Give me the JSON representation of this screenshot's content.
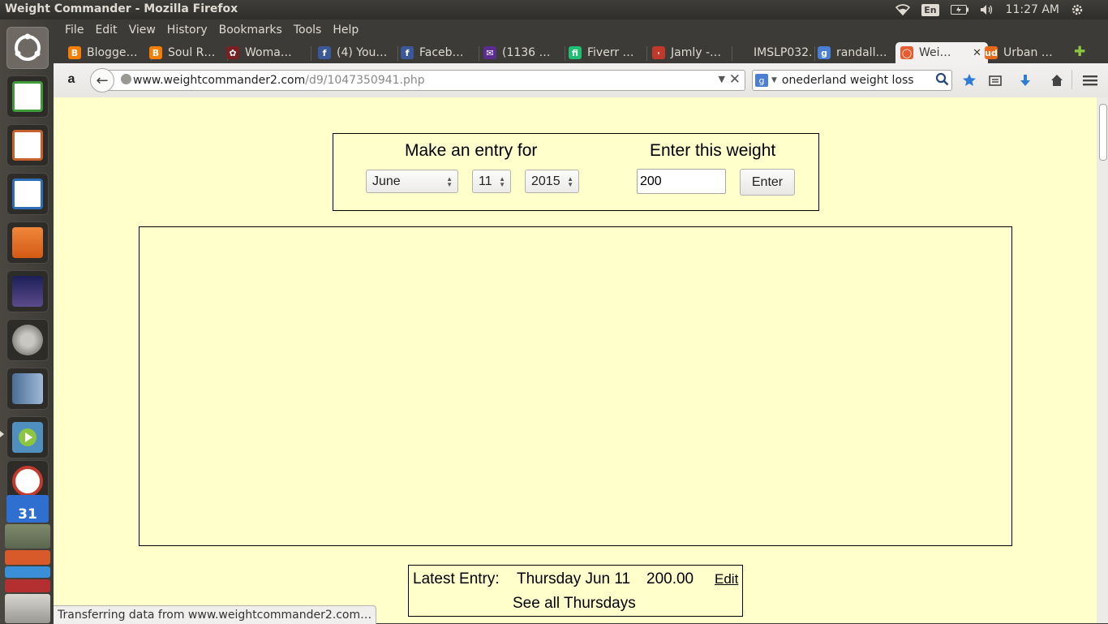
{
  "window": {
    "title": "Weight Commander - Mozilla Firefox"
  },
  "top_panel": {
    "lang": "En",
    "time": "11:27 AM"
  },
  "launcher": {
    "items": [
      {
        "name": "dash-icon",
        "color": "#7a766f"
      },
      {
        "name": "spreadsheet-icon",
        "color": "#3f9a3a"
      },
      {
        "name": "presentation-icon",
        "color": "#c8602c"
      },
      {
        "name": "writer-icon",
        "color": "#2e6eb5"
      },
      {
        "name": "files-icon",
        "color": "#e2701f"
      },
      {
        "name": "stellarium-icon",
        "color": "#2a2f6e"
      },
      {
        "name": "settings-icon",
        "color": "#9a9892"
      },
      {
        "name": "reader-icon",
        "color": "#5a7ea8"
      },
      {
        "name": "video-player-icon",
        "color": "#4f8fbf"
      },
      {
        "name": "alarm-clock-icon",
        "color": "#c23a2b"
      }
    ],
    "calendar_day": "31"
  },
  "menu": [
    "File",
    "Edit",
    "View",
    "History",
    "Bookmarks",
    "Tools",
    "Help"
  ],
  "tabs": [
    {
      "label": "Blogge…",
      "fav": "B",
      "color": "#f57d00"
    },
    {
      "label": "Soul R…",
      "fav": "B",
      "color": "#f57d00"
    },
    {
      "label": "Woma…",
      "fav": "✿",
      "color": "#7a2020"
    },
    {
      "label": "(4) You…",
      "fav": "f",
      "color": "#3b5998"
    },
    {
      "label": "Faceb…",
      "fav": "f",
      "color": "#3b5998"
    },
    {
      "label": "(1136 …",
      "fav": "✉",
      "color": "#5c2d91"
    },
    {
      "label": "Fiverr …",
      "fav": "fi",
      "color": "#1dbf73"
    },
    {
      "label": "Jamly -…",
      "fav": "·",
      "color": "#c0392b"
    },
    {
      "label": "IMSLP032…",
      "fav": "",
      "color": "transparent"
    },
    {
      "label": "randall…",
      "fav": "g",
      "color": "#4a7fd6"
    },
    {
      "label": "Wei…",
      "fav": "◯",
      "color": "#e65c2e",
      "selected": true
    },
    {
      "label": "Urban …",
      "fav": "ud",
      "color": "#e86a1a"
    }
  ],
  "nav": {
    "url_host": "www.weightcommander2.com",
    "url_path": "/d9/1047350941.php",
    "search_value": "onederland weight loss"
  },
  "form": {
    "make_entry_label": "Make an entry for",
    "enter_weight_label": "Enter this weight",
    "month": "June",
    "day": "11",
    "year": "2015",
    "weight": "200",
    "enter_button": "Enter"
  },
  "latest": {
    "label": "Latest Entry:",
    "date": "Thursday Jun 11",
    "weight": "200.00",
    "edit": "Edit",
    "see_all": "See all Thursdays"
  },
  "status": {
    "text": "Transferring data from www.weightcommander2.com…"
  }
}
